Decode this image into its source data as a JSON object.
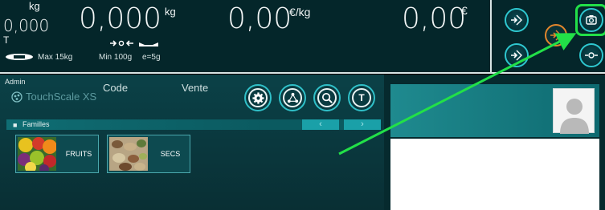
{
  "display": {
    "tare_unit": "kg",
    "tare_value": "0,000",
    "tare_flag": "T",
    "weight_value": "0,000",
    "weight_unit": "kg",
    "price_per_kg_value": "0,00",
    "price_per_kg_unit": "€/kg",
    "total_value": "0,00",
    "total_unit": "€",
    "max_label": "Max 15kg",
    "min_label": "Min 100g",
    "e_label": "e=5g"
  },
  "panel": {
    "user": "Admin",
    "brand": "TouchScale XS",
    "code_label": "Code",
    "vente_label": "Vente",
    "families_label": "Familles",
    "prev_glyph": "‹",
    "next_glyph": "›",
    "tool_t_label": "T"
  },
  "families": [
    {
      "label": "FRUITS"
    },
    {
      "label": "SECS"
    }
  ],
  "colors": {
    "accent": "#2ec7cf",
    "orange": "#e2862c",
    "highlight": "#22e048"
  },
  "icons": [
    "zero-icon",
    "tare-icon",
    "camera-icon",
    "zero-set-icon",
    "settings-icon",
    "share-icon",
    "search-icon",
    "user-avatar-icon"
  ]
}
